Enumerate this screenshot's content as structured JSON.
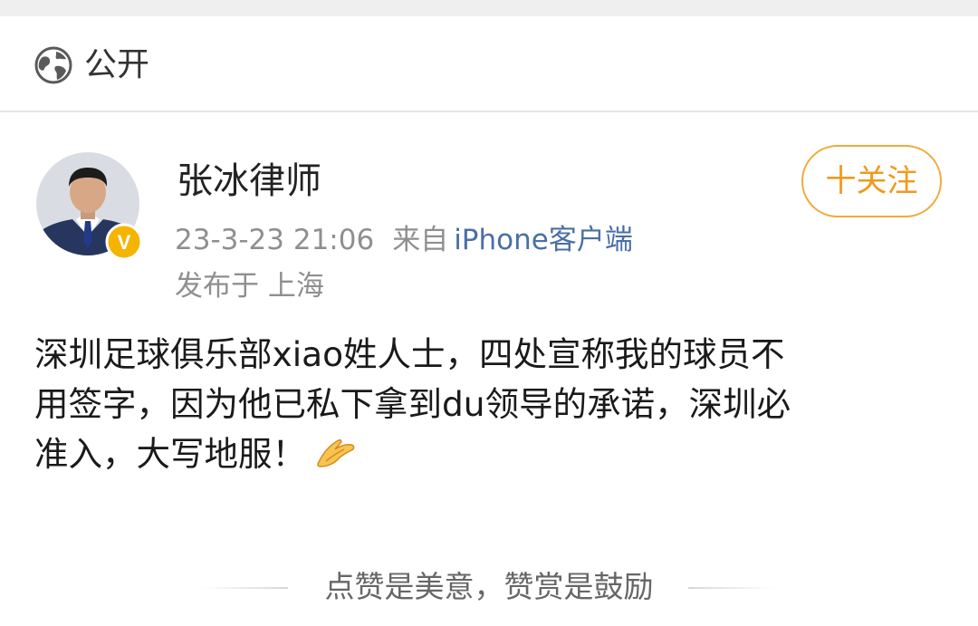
{
  "visibility": {
    "label": "公开",
    "icon": "globe-icon"
  },
  "author": {
    "name": "张冰律师",
    "verified_badge_icon": "verified-v-icon",
    "badge_letter": "V",
    "avatar_icon": "avatar"
  },
  "follow_button": {
    "label": "十关注"
  },
  "meta": {
    "timestamp": "23-3-23 21:06",
    "from_label": "来自",
    "client": "iPhone客户端",
    "location": "发布于 上海"
  },
  "post": {
    "lines": [
      "深圳足球俱乐部xiao姓人士，四处宣称我的球员不",
      "用签字，因为他已私下拿到du领导的承诺，深圳必",
      "准入，大写地服！"
    ],
    "trailing_emoji": "folded-hands-emoji"
  },
  "reward": {
    "text": "点赞是美意，赞赏是鼓励"
  },
  "colors": {
    "accent_orange": "#f09a1a",
    "link_blue": "#4a6fa6",
    "badge_gold": "#f5b400"
  }
}
